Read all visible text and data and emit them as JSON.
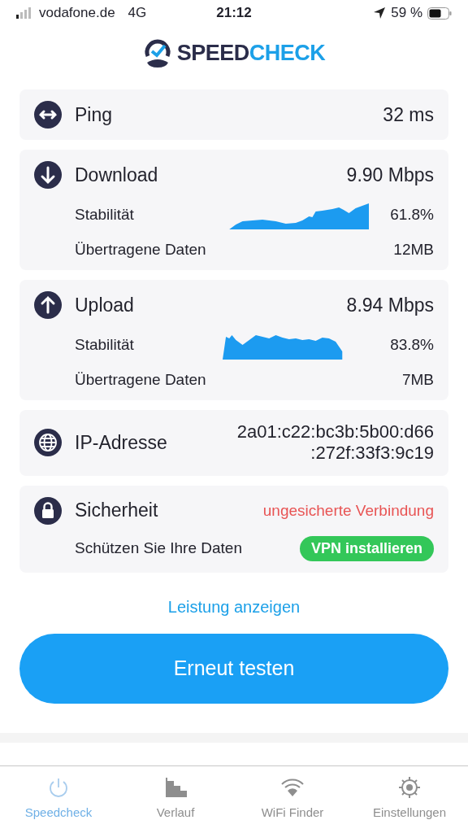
{
  "status_bar": {
    "carrier": "vodafone.de",
    "network": "4G",
    "time": "21:12",
    "battery": "59 %"
  },
  "logo": {
    "part_1": "SPEED",
    "part_2": "CHECK"
  },
  "cards": [
    {
      "kind": "ping",
      "title": "Ping",
      "value": "32 ms"
    },
    {
      "kind": "download",
      "title": "Download",
      "value": "9.90 Mbps",
      "stability_label": "Stabilität",
      "stability": "61.8%",
      "data_label": "Übertragene Daten",
      "data": "12MB"
    },
    {
      "kind": "upload",
      "title": "Upload",
      "value": "8.94 Mbps",
      "stability_label": "Stabilität",
      "stability": "83.8%",
      "data_label": "Übertragene Daten",
      "data": "7MB"
    },
    {
      "kind": "ip",
      "title": "IP-Adresse",
      "value_lines": [
        "2a01:c22:bc3b:5b00:d66",
        ":272f:33f3:9c19"
      ]
    },
    {
      "kind": "security",
      "title": "Sicherheit",
      "value": "ungesicherte Verbindung",
      "hint": "Schützen Sie Ihre Daten",
      "action": "VPN installieren"
    }
  ],
  "link": "Leistung anzeigen",
  "button": "Erneut testen",
  "tabs": [
    {
      "label": "Speedcheck",
      "selected": true
    },
    {
      "label": "Verlauf",
      "selected": false
    },
    {
      "label": "WiFi Finder",
      "selected": false
    },
    {
      "label": "Einstellungen",
      "selected": false
    }
  ]
}
